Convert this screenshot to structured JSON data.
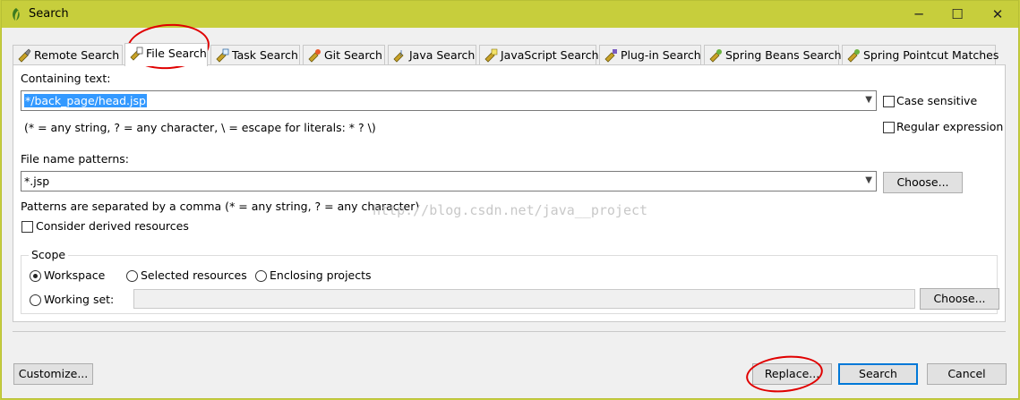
{
  "window": {
    "title": "Search",
    "minimize": "─",
    "maximize": "☐",
    "close": "✕"
  },
  "tabs": [
    {
      "label": "Remote Search"
    },
    {
      "label": "File Search"
    },
    {
      "label": "Task Search"
    },
    {
      "label": "Git Search"
    },
    {
      "label": "Java Search"
    },
    {
      "label": "JavaScript Search"
    },
    {
      "label": "Plug-in Search"
    },
    {
      "label": "Spring Beans Search"
    },
    {
      "label": "Spring Pointcut Matches"
    }
  ],
  "containing": {
    "label": "Containing text:",
    "value": "*/back_page/head.jsp",
    "hint": "(* = any string, ? = any character, \\ = escape for literals: * ? \\)",
    "case_sensitive": "Case sensitive",
    "regular_expression": "Regular expression"
  },
  "file_patterns": {
    "label": "File name patterns:",
    "value": "*.jsp",
    "choose_label": "Choose...",
    "hint": "Patterns are separated by a comma (* = any string, ? = any character)",
    "consider_derived": "Consider derived resources"
  },
  "watermark": "http://blog.csdn.net/java__project",
  "scope": {
    "title": "Scope",
    "workspace": "Workspace",
    "selected_resources": "Selected resources",
    "enclosing_projects": "Enclosing projects",
    "working_set": "Working set:",
    "choose_label": "Choose..."
  },
  "footer": {
    "customize_label": "Customize...",
    "replace_label": "Replace...",
    "search_label": "Search",
    "cancel_label": "Cancel"
  },
  "colors": {
    "titlebar": "#c7ce3c",
    "selection": "#3399ff",
    "annotation": "#e00000"
  }
}
